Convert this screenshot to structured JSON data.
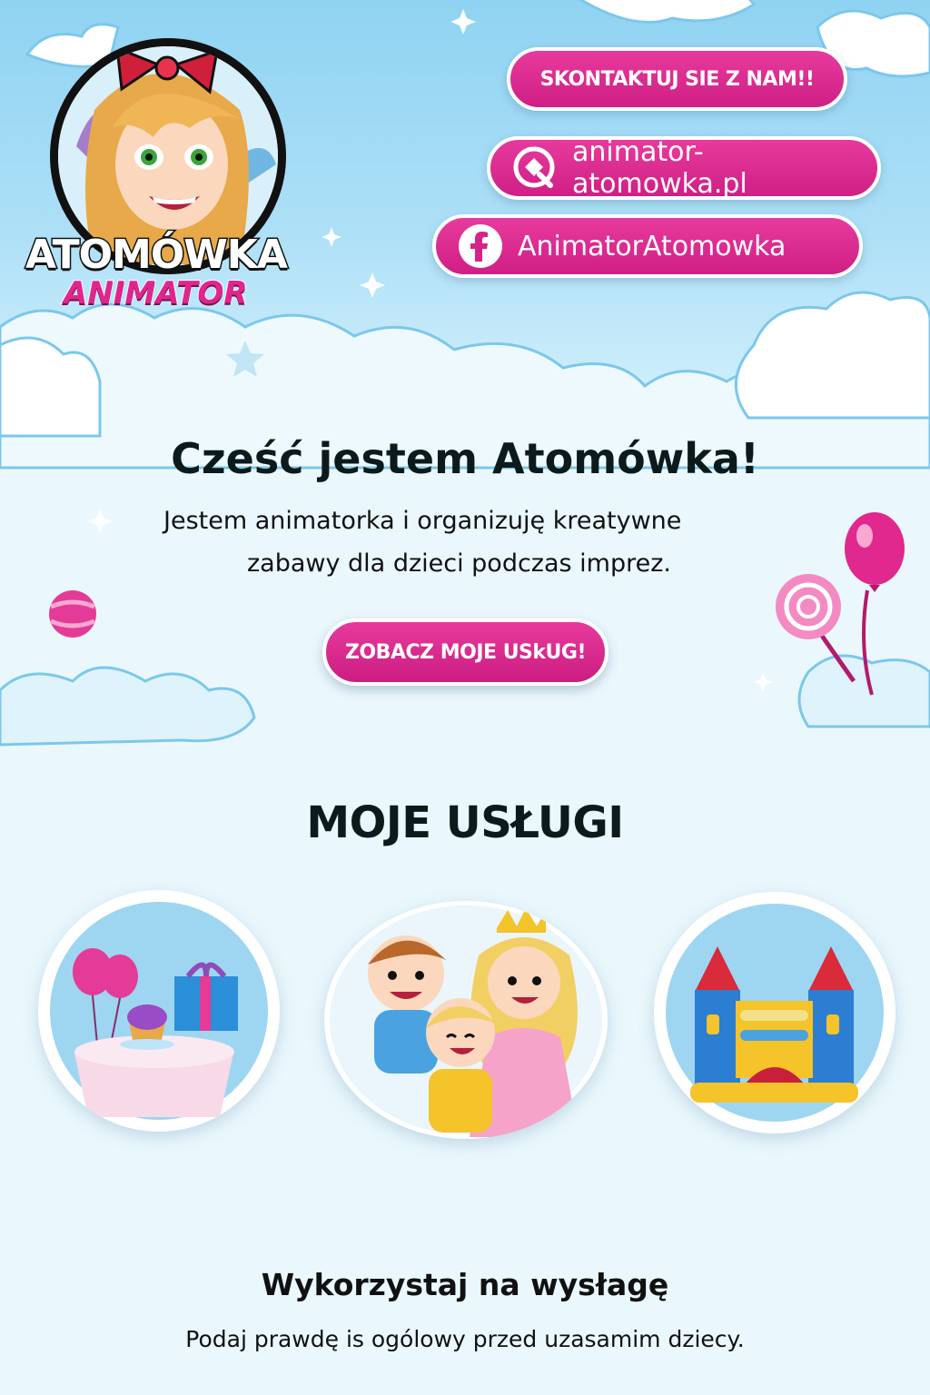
{
  "colors": {
    "accent": "#e0258f",
    "sky": "#8fd3f2",
    "page_bg": "#eaf8fd"
  },
  "logo": {
    "line1": "ATOMÓWKA",
    "line2": "ANIMATOR"
  },
  "header": {
    "contact_label": "SKONTAKTUJ SIE Z NAM!!",
    "website_label": "animator-atomowka.pl",
    "website_icon": "globe-icon",
    "facebook_label": "AnimatorAtomowka",
    "facebook_icon": "facebook-icon"
  },
  "hero": {
    "title": "Cześć jestem Atomówka!",
    "subtitle_line1": "Jestem animatorka i organizuję kreatywne",
    "subtitle_line2": "zabawy dla dzieci podczas imprez.",
    "cta_label": "ZOBACZ MOJE USkUG!"
  },
  "services": {
    "title": "MOJE USŁUGI",
    "items": [
      {
        "icon": "party-table-icon"
      },
      {
        "icon": "kids-characters-icon"
      },
      {
        "icon": "bouncy-castle-icon"
      }
    ]
  },
  "footer": {
    "title": "Wykorzystaj na wysłagę",
    "subtitle": "Podaj prawdę is ogólowy przed uzasamim dziecy."
  }
}
